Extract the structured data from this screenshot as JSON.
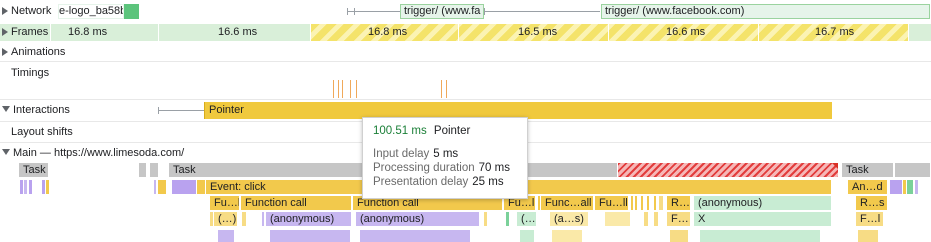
{
  "tracks": {
    "network": "Network",
    "frames": "Frames",
    "animations": "Animations",
    "timings": "Timings",
    "interactions": "Interactions",
    "layout_shifts": "Layout shifts",
    "main": "Main — https://www.limesoda.com/"
  },
  "network": {
    "request1": "e-logo_ba58b…",
    "request2": "trigger/ (www.fa",
    "request3": "trigger/ (www.facebook.com)"
  },
  "frames": [
    "16.8 ms",
    "16.6 ms",
    "16.8 ms",
    "16.5 ms",
    "16.6 ms",
    "16.7 ms"
  ],
  "interactions": {
    "bar": "Pointer"
  },
  "tooltip": {
    "duration": "100.51 ms",
    "type": "Pointer",
    "input_delay_label": "Input delay",
    "input_delay": "5 ms",
    "processing_label": "Processing duration",
    "processing": "70 ms",
    "presentation_label": "Presentation delay",
    "presentation": "25 ms"
  },
  "main": {
    "task1": "Task",
    "task2": "Task",
    "task3": "Task",
    "event_click": "Event: click",
    "anon_d": "An…d",
    "fu1": "Fu…l",
    "function_call_1": "Function call",
    "function_call_2": "Function call",
    "fu2": "Fu…ll",
    "func_all_1": "Func…all",
    "fu3": "Fu…ll",
    "r1": "R…",
    "anonymous_right": "(anonymous)",
    "r2": "R…s",
    "dots1": "(…)",
    "anonymous_1": "(anonymous)",
    "anonymous_2": "(anonymous)",
    "paren_dots": "(…",
    "a_s": "(a…s)",
    "f1": "F…",
    "x_label": "X",
    "f2": "F…l"
  },
  "colors": {
    "task": "#c6c6c6",
    "scripting": "#f2c94c",
    "rendering": "#c7b7f0",
    "painting": "#c8ecd3",
    "frames": "#d9efd9",
    "long_task": "#e23c3c"
  }
}
